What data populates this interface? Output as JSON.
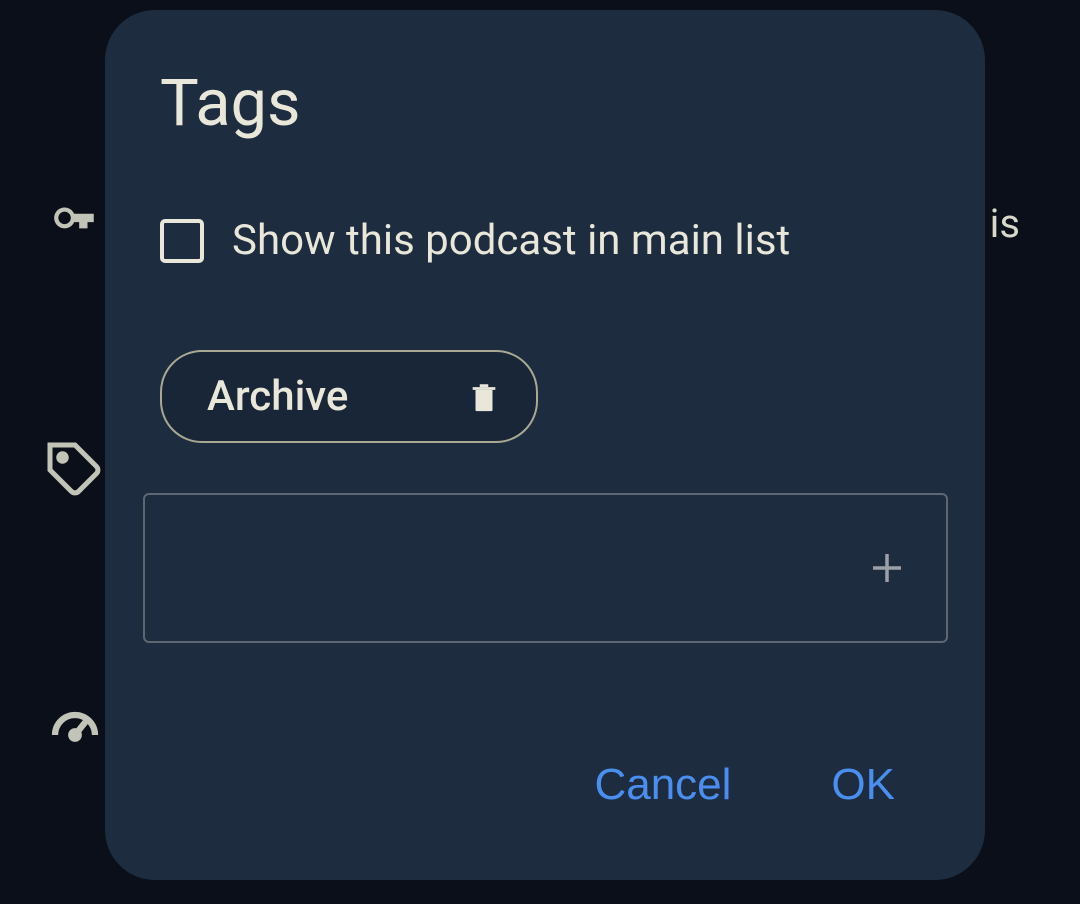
{
  "dialog": {
    "title": "Tags",
    "checkbox": {
      "label": "Show this podcast in main list",
      "checked": false
    },
    "tags": [
      {
        "label": "Archive"
      }
    ],
    "input": {
      "value": "",
      "placeholder": ""
    },
    "actions": {
      "cancel": "Cancel",
      "ok": "OK"
    }
  },
  "background": {
    "rightText": "is"
  }
}
